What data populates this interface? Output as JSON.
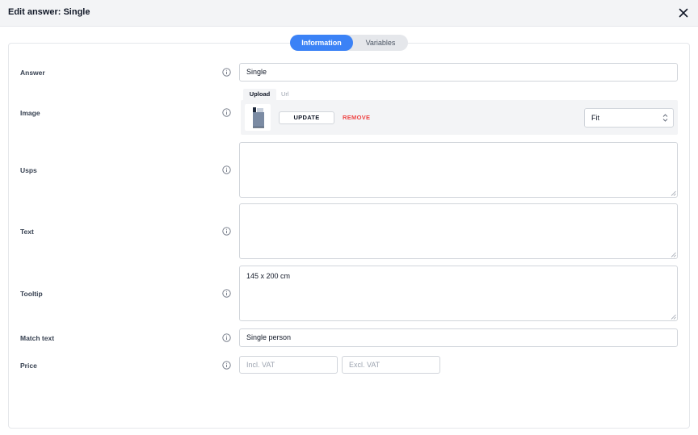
{
  "header": {
    "title": "Edit answer: Single"
  },
  "tabs": [
    {
      "label": "Information",
      "active": true
    },
    {
      "label": "Variables",
      "active": false
    }
  ],
  "labels": {
    "answer": "Answer",
    "image": "Image",
    "usps": "Usps",
    "text": "Text",
    "tooltip": "Tooltip",
    "match_text": "Match text",
    "price": "Price"
  },
  "fields": {
    "answer": "Single",
    "usps": "",
    "text": "",
    "tooltip": "145 x 200 cm",
    "match_text": "Single person",
    "price_incl_placeholder": "Incl. VAT",
    "price_excl_placeholder": "Excl. VAT"
  },
  "image": {
    "tabs": [
      "Upload",
      "Url"
    ],
    "update_label": "UPDATE",
    "remove_label": "REMOVE",
    "fit_value": "Fit"
  },
  "colors": {
    "accent": "#3b82f6",
    "danger": "#ef4444",
    "header_bg": "#f3f4f6"
  },
  "icons": {
    "close": "close-icon",
    "info": "info-icon",
    "select_arrows": "chevron-up-down-icon"
  }
}
